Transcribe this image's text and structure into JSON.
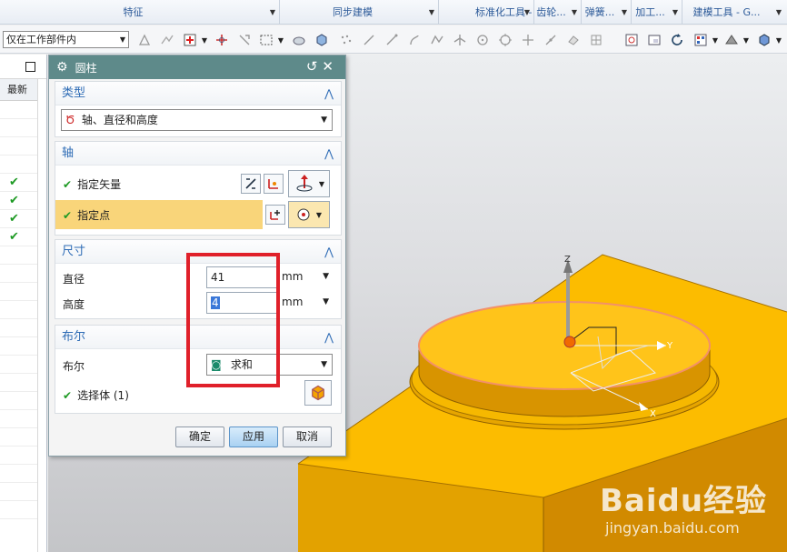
{
  "ribbon": {
    "groups": [
      {
        "label": "特征",
        "w": 308
      },
      {
        "label": "同步建模",
        "w": 175
      },
      {
        "label": "标准化工具 - G...",
        "w": 105
      },
      {
        "label": "齿轮...",
        "w": 52
      },
      {
        "label": "弹簧...",
        "w": 55
      },
      {
        "label": "加工...",
        "w": 56
      },
      {
        "label": "建模工具 - G...",
        "w": 75
      }
    ]
  },
  "toolbar": {
    "filter_value": "仅在工作部件内"
  },
  "left_panel": {
    "latest_header": "最新",
    "check_glyph": "✔"
  },
  "dialog": {
    "title": "圆柱",
    "title_icons": {
      "gear": "gear-icon",
      "reset": "↺",
      "close": "✕"
    },
    "sections": {
      "type": {
        "header": "类型",
        "value": "轴、直径和高度"
      },
      "axis": {
        "header": "轴",
        "specify_vector": "指定矢量",
        "specify_point": "指定点"
      },
      "dimensions": {
        "header": "尺寸",
        "diameter_label": "直径",
        "diameter_value": "41",
        "height_label": "高度",
        "height_value": "4",
        "unit": "mm"
      },
      "boolean": {
        "header": "布尔",
        "boolean_label": "布尔",
        "boolean_value": "求和",
        "select_body": "选择体 (1)"
      }
    },
    "buttons": {
      "ok": "确定",
      "apply": "应用",
      "cancel": "取消"
    }
  },
  "viewport": {
    "axis_labels": {
      "x": "X",
      "y": "Y",
      "z": "Z"
    },
    "colors": {
      "block": "#f5b800",
      "block_side": "#d48600",
      "accent_red": "#e0202a"
    }
  },
  "watermark": {
    "brand": "Baidu经验",
    "site": "jingyan.baidu.com"
  }
}
